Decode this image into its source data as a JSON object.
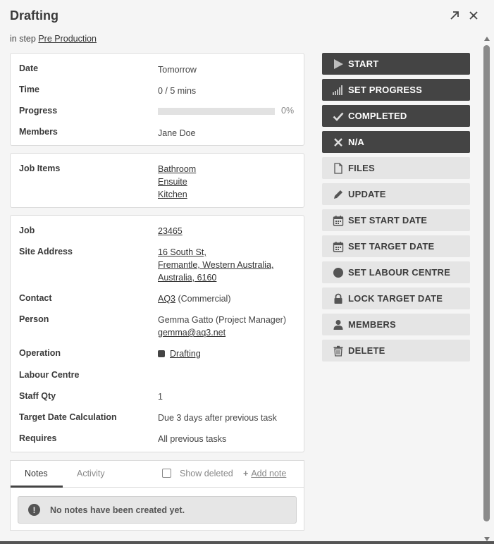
{
  "header": {
    "title": "Drafting",
    "step_prefix": "in step",
    "step_link": "Pre Production"
  },
  "summary": {
    "date_label": "Date",
    "date_value": "Tomorrow",
    "time_label": "Time",
    "time_value": "0 / 5 mins",
    "progress_label": "Progress",
    "progress_percent": 0,
    "progress_text": "0%",
    "members_label": "Members",
    "members_value": "Jane Doe"
  },
  "job_items": {
    "label": "Job Items",
    "items": [
      "Bathroom",
      "Ensuite",
      "Kitchen"
    ]
  },
  "details": {
    "job_label": "Job",
    "job_value": "23465",
    "site_label": "Site Address",
    "site_lines": [
      "16 South St,",
      "Fremantle, Western Australia,",
      "Australia, 6160"
    ],
    "contact_label": "Contact",
    "contact_link": "AQ3",
    "contact_suffix": " (Commercial)",
    "person_label": "Person",
    "person_name": "Gemma Gatto (Project Manager)",
    "person_email": "gemma@aq3.net",
    "operation_label": "Operation",
    "operation_value": "Drafting",
    "operation_color": "#444444",
    "labour_label": "Labour Centre",
    "labour_value": "",
    "staff_label": "Staff Qty",
    "staff_value": "1",
    "target_label": "Target Date Calculation",
    "target_value": "Due 3 days after previous task",
    "requires_label": "Requires",
    "requires_value": "All previous tasks"
  },
  "actions": [
    {
      "label": "START",
      "icon": "play-icon",
      "style": "dark"
    },
    {
      "label": "SET PROGRESS",
      "icon": "signal-bars-icon",
      "style": "dark"
    },
    {
      "label": "COMPLETED",
      "icon": "check-icon",
      "style": "dark"
    },
    {
      "label": "N/A",
      "icon": "x-icon",
      "style": "dark"
    },
    {
      "label": "FILES",
      "icon": "file-icon",
      "style": "light"
    },
    {
      "label": "UPDATE",
      "icon": "pencil-icon",
      "style": "light"
    },
    {
      "label": "SET START DATE",
      "icon": "calendar-icon",
      "style": "light"
    },
    {
      "label": "SET TARGET DATE",
      "icon": "calendar-icon",
      "style": "light"
    },
    {
      "label": "SET LABOUR CENTRE",
      "icon": "circle-icon",
      "style": "light"
    },
    {
      "label": "LOCK TARGET DATE",
      "icon": "lock-icon",
      "style": "light"
    },
    {
      "label": "MEMBERS",
      "icon": "person-icon",
      "style": "light"
    },
    {
      "label": "DELETE",
      "icon": "trash-icon",
      "style": "light"
    }
  ],
  "notes": {
    "tab_notes": "Notes",
    "tab_activity": "Activity",
    "show_deleted": "Show deleted",
    "add_note": "Add note",
    "empty_message": "No notes have been created yet."
  }
}
